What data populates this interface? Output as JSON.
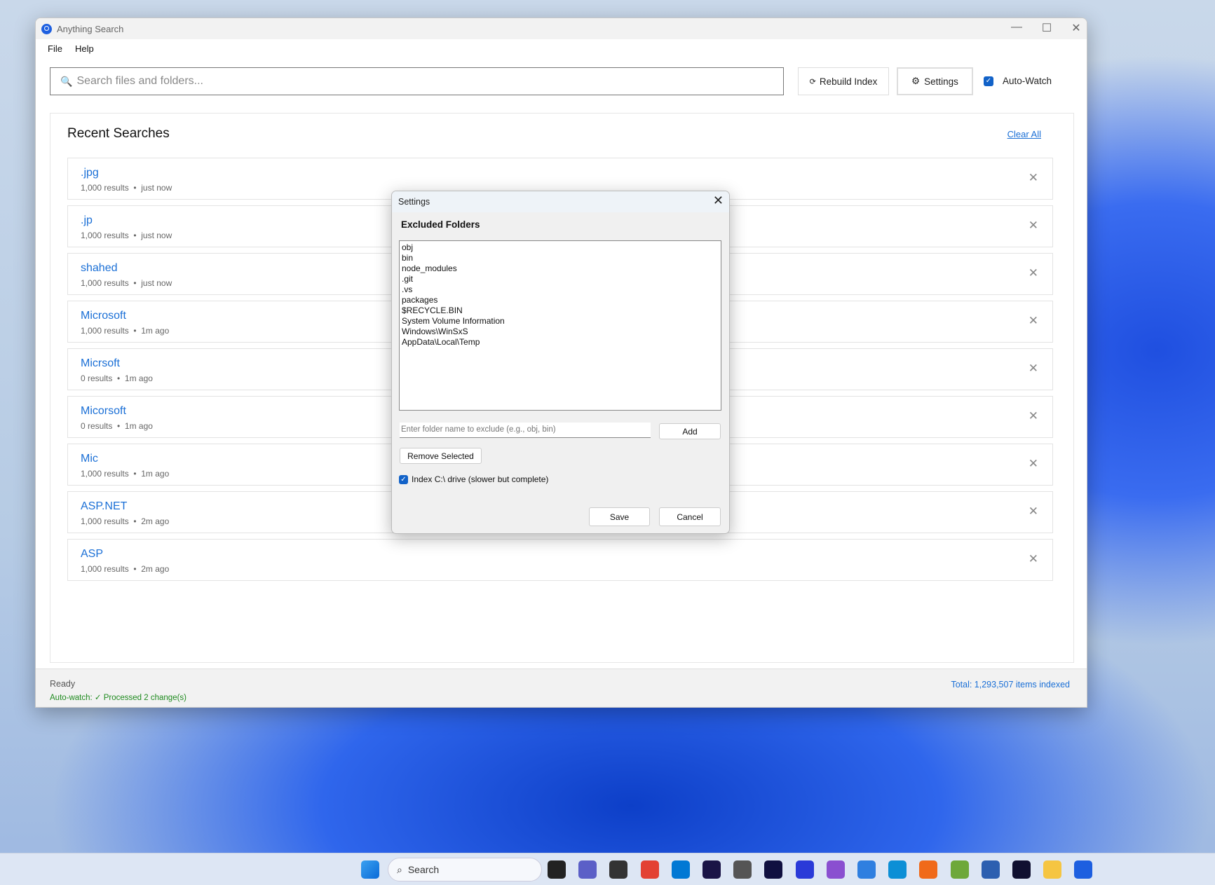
{
  "window": {
    "title": "Anything Search",
    "menu": [
      "File",
      "Help"
    ]
  },
  "toolbar": {
    "search_placeholder": "Search files and folders...",
    "rebuild_label": "Rebuild Index",
    "settings_label": "Settings",
    "autowatch_label": "Auto-Watch",
    "autowatch_checked": true
  },
  "recent": {
    "title": "Recent Searches",
    "clear_all": "Clear All",
    "items": [
      {
        "term": ".jpg",
        "meta": "1,000 results  •  just now"
      },
      {
        "term": ".jp",
        "meta": "1,000 results  •  just now"
      },
      {
        "term": "shahed",
        "meta": "1,000 results  •  just now"
      },
      {
        "term": "Microsoft",
        "meta": "1,000 results  •  1m ago"
      },
      {
        "term": "Micrsoft",
        "meta": "0 results  •  1m ago"
      },
      {
        "term": "Micorsoft",
        "meta": "0 results  •  1m ago"
      },
      {
        "term": "Mic",
        "meta": "1,000 results  •  1m ago"
      },
      {
        "term": "ASP.NET",
        "meta": "1,000 results  •  2m ago"
      },
      {
        "term": "ASP",
        "meta": "1,000 results  •  2m ago"
      }
    ]
  },
  "status": {
    "ready": "Ready",
    "autowatch": "Auto-watch: ✓ Processed 2 change(s)",
    "total": "Total: 1,293,507 items indexed"
  },
  "dialog": {
    "title": "Settings",
    "heading": "Excluded Folders",
    "folders": [
      "obj",
      "bin",
      "node_modules",
      ".git",
      ".vs",
      "packages",
      "$RECYCLE.BIN",
      "System Volume Information",
      "Windows\\WinSxS",
      "AppData\\Local\\Temp"
    ],
    "input_placeholder": "Enter folder name to exclude (e.g., obj, bin)",
    "add": "Add",
    "remove": "Remove Selected",
    "index_c": "Index C:\\ drive (slower but complete)",
    "index_c_checked": true,
    "save": "Save",
    "cancel": "Cancel"
  },
  "taskbar": {
    "search": "Search"
  }
}
